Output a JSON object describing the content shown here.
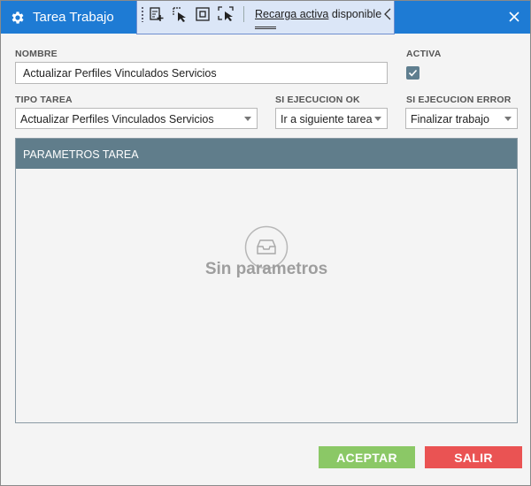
{
  "window": {
    "title": "Tarea Trabajo",
    "title_icon": "gear-icon",
    "close_icon": "close-icon",
    "accent": "#1e7bd4"
  },
  "devbar": {
    "tools": [
      "add-visual-tree-icon",
      "select-element-icon",
      "display-layout-adorners-icon",
      "track-focused-element-icon"
    ],
    "reload_link": "Recarga activa",
    "reload_suffix": " disponible",
    "collapse_icon": "chevron-left-icon"
  },
  "form": {
    "nombre_label": "NOMBRE",
    "nombre_value": "Actualizar Perfiles Vinculados Servicios",
    "activa_label": "ACTIVA",
    "activa_checked": true,
    "tipo_label": "TIPO TAREA",
    "tipo_value": "Actualizar Perfiles Vinculados Servicios",
    "ok_label": "SI EJECUCION OK",
    "ok_value": "Ir a siguiente tarea",
    "error_label": "SI EJECUCION ERROR",
    "error_value": "Finalizar trabajo"
  },
  "params": {
    "header": "PARAMETROS TAREA",
    "empty_text": "Sin parametros",
    "empty_icon": "inbox-icon"
  },
  "buttons": {
    "accept": "ACEPTAR",
    "exit": "SALIR",
    "accept_color": "#8bc866",
    "exit_color": "#ea5353"
  }
}
